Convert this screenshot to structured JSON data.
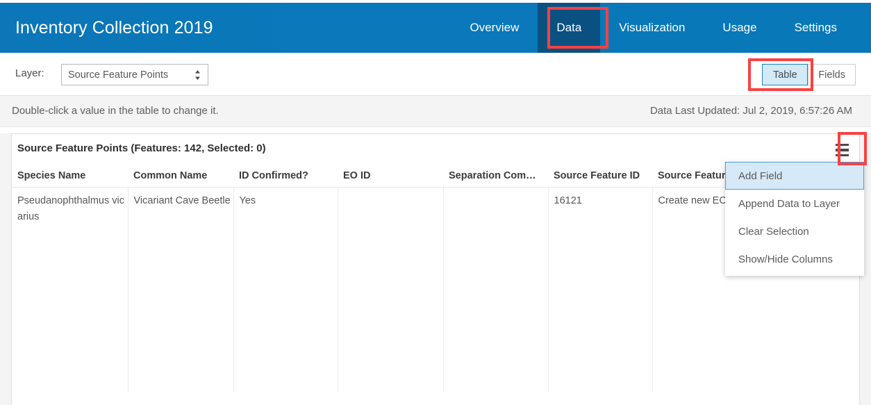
{
  "header": {
    "title": "Inventory Collection 2019",
    "brand_color": "#0a78ba",
    "active_tab_color": "#0a5182",
    "nav": [
      {
        "label": "Overview",
        "active": false
      },
      {
        "label": "Data",
        "active": true
      },
      {
        "label": "Visualization",
        "active": false
      },
      {
        "label": "Usage",
        "active": false
      },
      {
        "label": "Settings",
        "active": false
      }
    ]
  },
  "toolbar": {
    "layer_label": "Layer:",
    "layer_value": "Source Feature Points",
    "layer_icon": "updown-spinner-icon",
    "view_toggle": [
      {
        "label": "Table",
        "selected": true
      },
      {
        "label": "Fields",
        "selected": false
      }
    ],
    "toggle_selected_color": "#d4eaf7",
    "toggle_selected_border": "#1a83c7"
  },
  "infobar": {
    "hint": "Double-click a value in the table to change it.",
    "last_updated": "Data Last Updated: Jul 2, 2019, 6:57:26 AM"
  },
  "panel": {
    "title": "Source Feature Points (Features: 142, Selected: 0)",
    "menu_icon": "hamburger-menu-icon",
    "feature_count": 142,
    "selected_count": 0
  },
  "table": {
    "columns": [
      "Species Name",
      "Common Name",
      "ID Confirmed?",
      "EO ID",
      "Separation Com…",
      "Source Feature ID",
      "Source Feature ."
    ],
    "rows": [
      [
        "Pseudanophthalmus vicarius",
        "Vicariant Cave Beetle",
        "Yes",
        "",
        "",
        "16121",
        "Create new EO"
      ]
    ]
  },
  "dropdown": {
    "items": [
      {
        "label": "Add Field",
        "highlighted": true
      },
      {
        "label": "Append Data to Layer",
        "highlighted": false
      },
      {
        "label": "Clear Selection",
        "highlighted": false
      },
      {
        "label": "Show/Hide Columns",
        "highlighted": false
      }
    ],
    "highlight_color": "#d6e9f8",
    "highlight_border": "#4a9fdc"
  },
  "annotations": {
    "color": "#fc4040",
    "boxes": [
      "data-tab",
      "table-toggle",
      "hamburger-menu"
    ]
  }
}
